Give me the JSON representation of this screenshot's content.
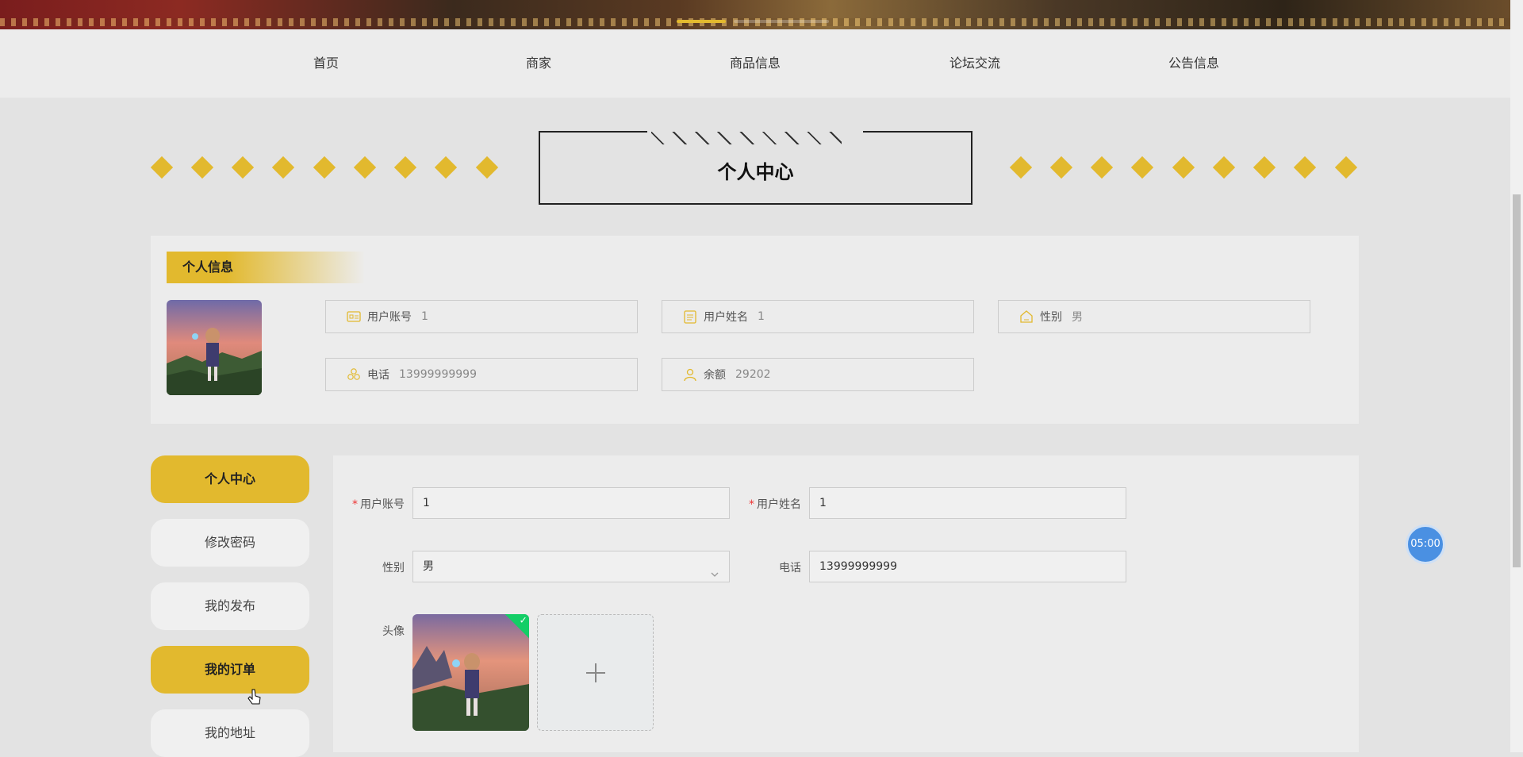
{
  "nav": {
    "items": [
      "首页",
      "商家",
      "商品信息",
      "论坛交流",
      "公告信息"
    ]
  },
  "page_title": "个人中心",
  "profile": {
    "section_title": "个人信息",
    "fields": [
      {
        "label": "用户账号",
        "value": "1",
        "icon": "id-card-icon"
      },
      {
        "label": "用户姓名",
        "value": "1",
        "icon": "document-icon"
      },
      {
        "label": "性别",
        "value": "男",
        "icon": "home-icon"
      },
      {
        "label": "电话",
        "value": "13999999999",
        "icon": "cubes-icon"
      },
      {
        "label": "余额",
        "value": "29202",
        "icon": "user-icon"
      }
    ]
  },
  "sidebar": {
    "items": [
      {
        "label": "个人中心",
        "active": true
      },
      {
        "label": "修改密码",
        "active": false
      },
      {
        "label": "我的发布",
        "active": false
      },
      {
        "label": "我的订单",
        "active": true
      },
      {
        "label": "我的地址",
        "active": false
      }
    ]
  },
  "form": {
    "account_label": "用户账号",
    "account_value": "1",
    "name_label": "用户姓名",
    "name_value": "1",
    "gender_label": "性别",
    "gender_value": "男",
    "phone_label": "电话",
    "phone_value": "13999999999",
    "avatar_label": "头像",
    "required_mark": "*"
  },
  "timer": "05:00",
  "colors": {
    "accent": "#e2b92e",
    "success": "#13ce66",
    "timer": "#4a90e2"
  }
}
